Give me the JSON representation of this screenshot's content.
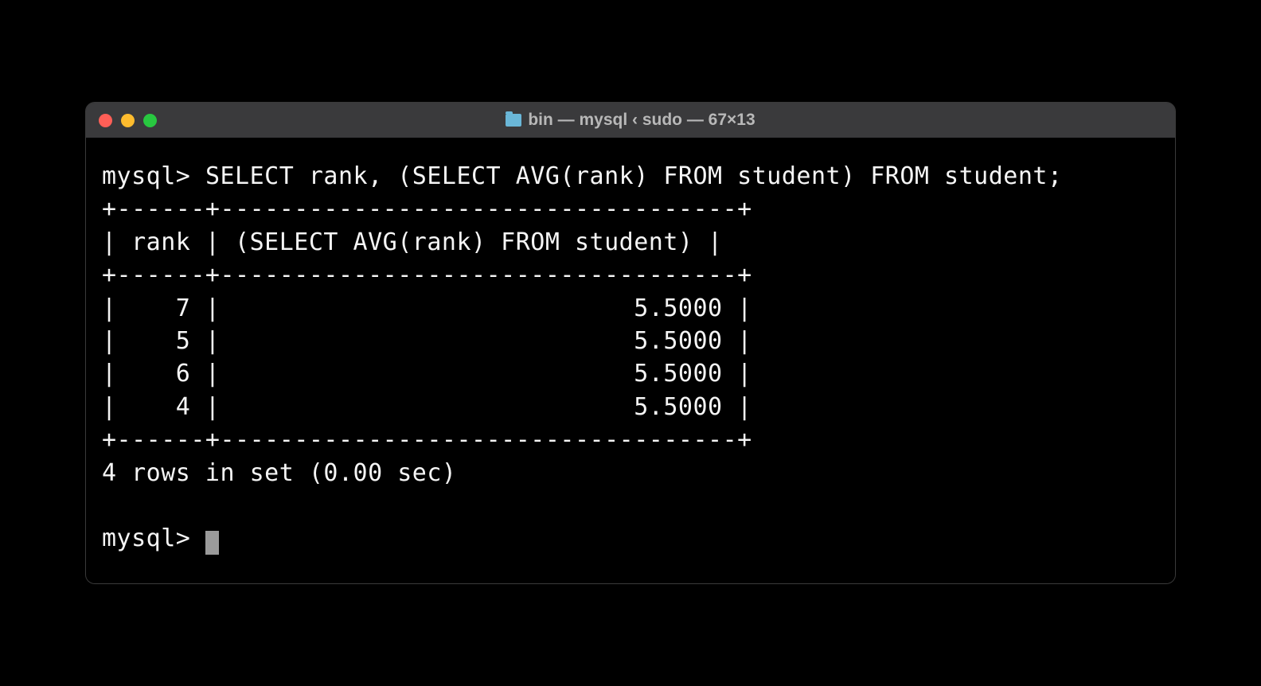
{
  "window": {
    "title": "bin — mysql ‹ sudo — 67×13"
  },
  "terminal": {
    "prompt": "mysql>",
    "command": "SELECT rank, (SELECT AVG(rank) FROM student) FROM student;",
    "table": {
      "border_top": "+------+-----------------------------------+",
      "header": "| rank | (SELECT AVG(rank) FROM student) |",
      "border_mid": "+------+-----------------------------------+",
      "rows": [
        "|    7 |                            5.5000 |",
        "|    5 |                            5.5000 |",
        "|    6 |                            5.5000 |",
        "|    4 |                            5.5000 |"
      ],
      "border_bot": "+------+-----------------------------------+"
    },
    "summary": "4 rows in set (0.00 sec)",
    "prompt2": "mysql> "
  }
}
